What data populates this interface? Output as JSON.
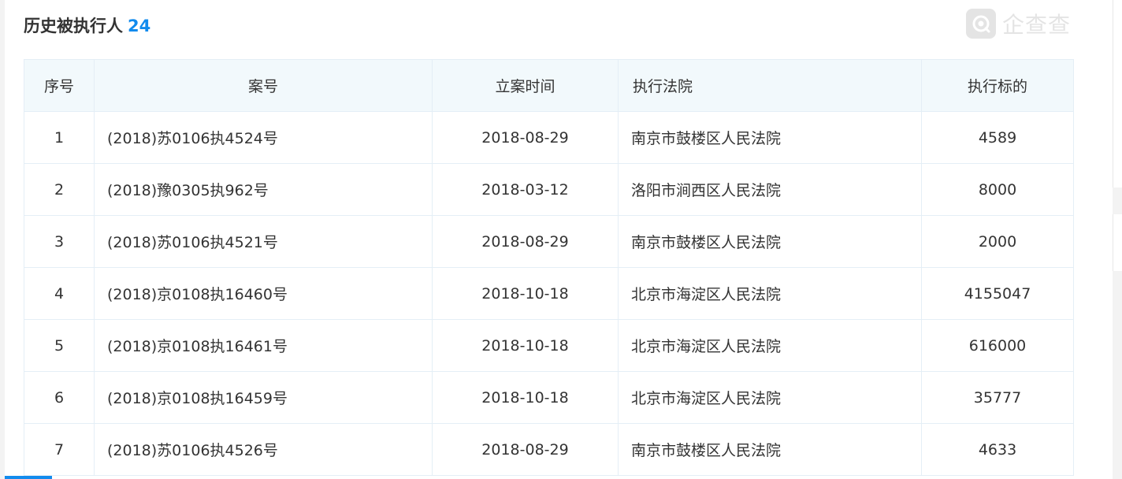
{
  "section": {
    "title": "历史被执行人",
    "count": "24"
  },
  "watermark": {
    "brand": "企查查",
    "icon": "qichacha-logo-icon"
  },
  "table": {
    "headers": {
      "index": "序号",
      "case_no": "案号",
      "filing_date": "立案时间",
      "court": "执行法院",
      "amount": "执行标的"
    },
    "rows": [
      {
        "index": "1",
        "case_no": "(2018)苏0106执4524号",
        "filing_date": "2018-08-29",
        "court": "南京市鼓楼区人民法院",
        "amount": "4589"
      },
      {
        "index": "2",
        "case_no": "(2018)豫0305执962号",
        "filing_date": "2018-03-12",
        "court": "洛阳市涧西区人民法院",
        "amount": "8000"
      },
      {
        "index": "3",
        "case_no": "(2018)苏0106执4521号",
        "filing_date": "2018-08-29",
        "court": "南京市鼓楼区人民法院",
        "amount": "2000"
      },
      {
        "index": "4",
        "case_no": "(2018)京0108执16460号",
        "filing_date": "2018-10-18",
        "court": "北京市海淀区人民法院",
        "amount": "4155047"
      },
      {
        "index": "5",
        "case_no": "(2018)京0108执16461号",
        "filing_date": "2018-10-18",
        "court": "北京市海淀区人民法院",
        "amount": "616000"
      },
      {
        "index": "6",
        "case_no": "(2018)京0108执16459号",
        "filing_date": "2018-10-18",
        "court": "北京市海淀区人民法院",
        "amount": "35777"
      },
      {
        "index": "7",
        "case_no": "(2018)苏0106执4526号",
        "filing_date": "2018-08-29",
        "court": "南京市鼓楼区人民法院",
        "amount": "4633"
      }
    ]
  },
  "colors": {
    "accent": "#128bed",
    "header_bg": "#f2f9fc",
    "border": "#e4eef6",
    "text": "#333333"
  }
}
